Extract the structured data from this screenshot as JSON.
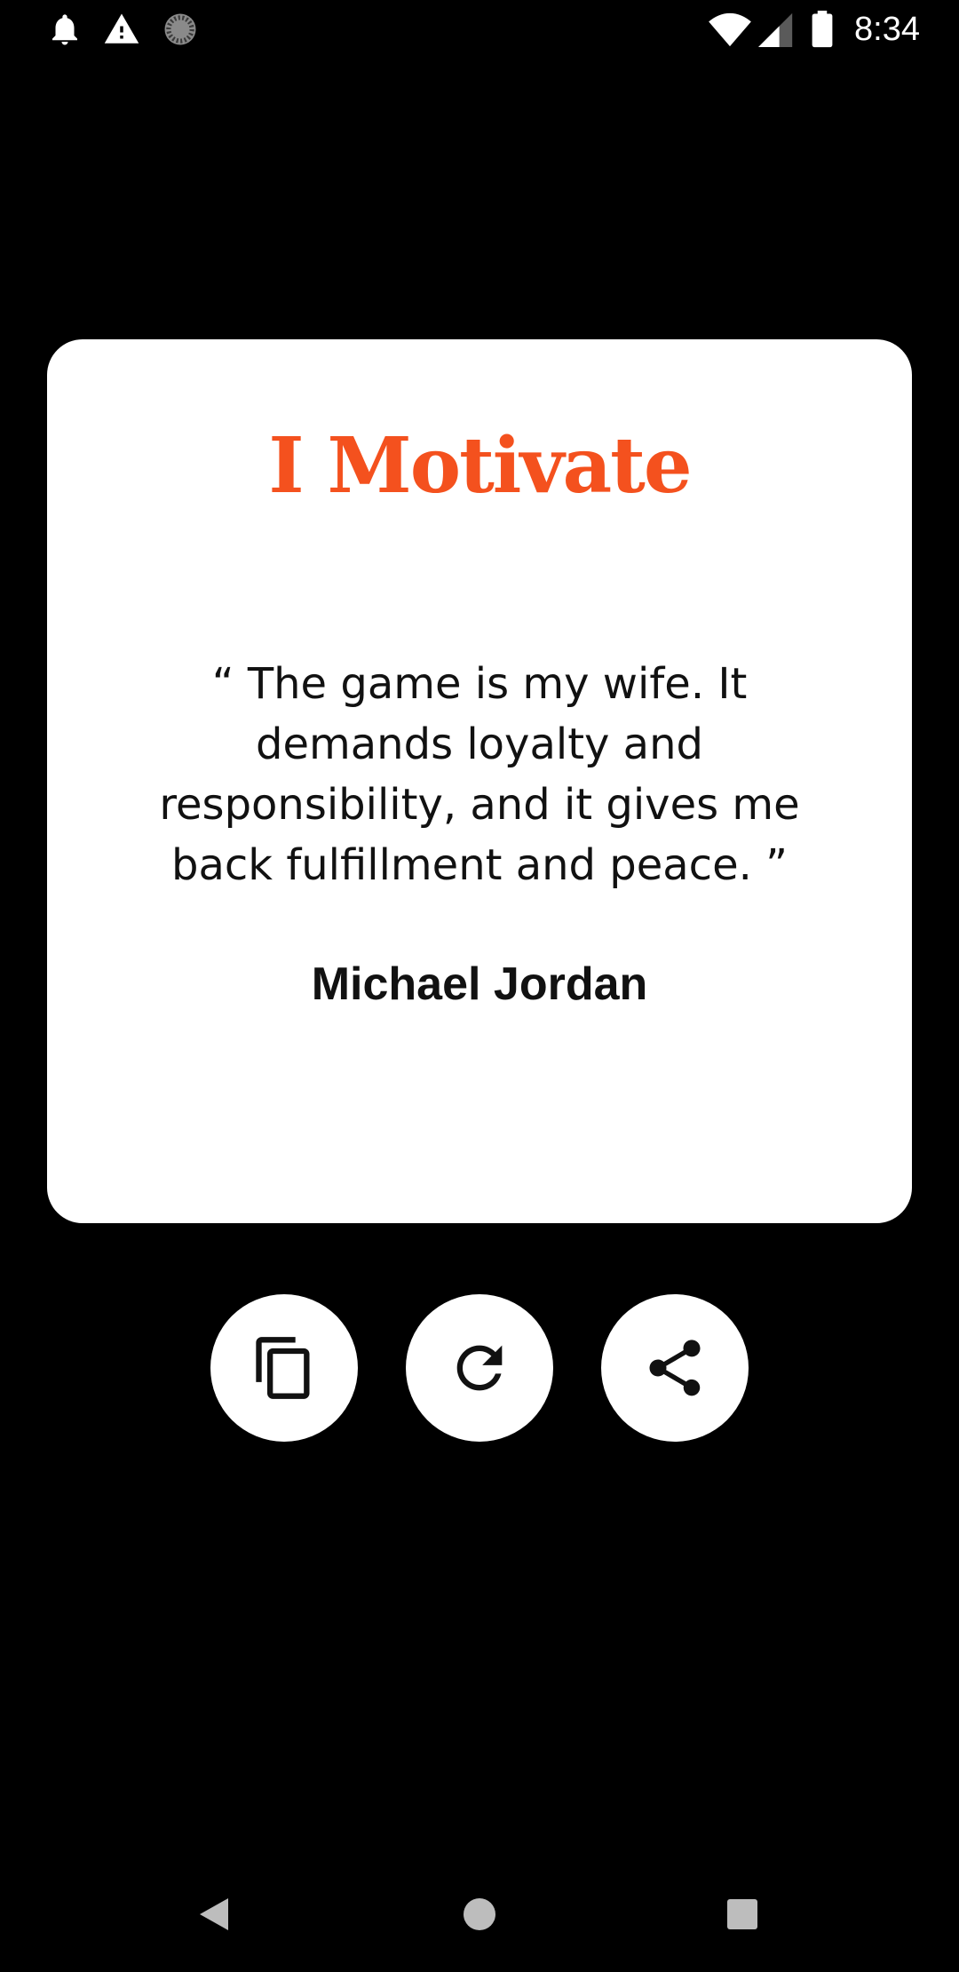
{
  "status_bar": {
    "time": "8:34",
    "left_icons": [
      "notification-bell-icon",
      "warning-icon",
      "loading-spinner-icon"
    ],
    "right_icons": [
      "wifi-icon",
      "cell-signal-icon",
      "battery-icon"
    ]
  },
  "card": {
    "title": "I Motivate",
    "quote": "“ The game is my wife. It demands loyalty and responsibility, and it gives me back fulfillment and peace. ”",
    "author": "Michael Jordan"
  },
  "actions": [
    {
      "name": "copy-button",
      "icon": "copy-icon"
    },
    {
      "name": "refresh-button",
      "icon": "refresh-icon"
    },
    {
      "name": "share-button",
      "icon": "share-icon"
    }
  ],
  "nav_bar": {
    "buttons": [
      "back-icon",
      "home-icon",
      "recents-icon"
    ]
  },
  "colors": {
    "background": "#000000",
    "card_background": "#ffffff",
    "title_accent": "#f4511e",
    "text": "#111111",
    "nav_icon": "#bdbdbd"
  }
}
